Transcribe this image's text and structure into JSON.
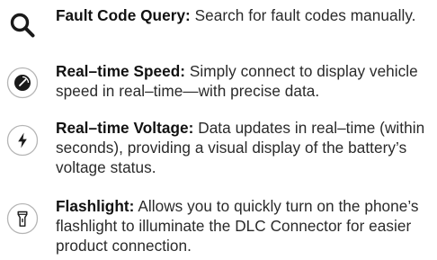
{
  "features": [
    {
      "id": "fault-code-query",
      "icon": "search-icon",
      "title": "Fault Code Query:",
      "description": "Search for fault codes manually."
    },
    {
      "id": "real-time-speed",
      "icon": "speedometer-icon",
      "title": "Real–time Speed:",
      "description": "Simply connect to display vehicle speed in real–time—with precise data."
    },
    {
      "id": "real-time-voltage",
      "icon": "lightning-bolt-icon",
      "title": "Real–time Voltage:",
      "description": "Data updates in real–time (within seconds), providing a visual display of the battery’s voltage status."
    },
    {
      "id": "flashlight",
      "icon": "flashlight-icon",
      "title": "Flashlight:",
      "description": "Allows you to quickly turn on the phone’s flashlight to illuminate the DLC Connector for easier product connection."
    }
  ],
  "colors": {
    "text": "#2a2a2a",
    "title": "#111111",
    "icon_stroke": "#1a1a1a",
    "icon_border": "#b5b5b5"
  }
}
